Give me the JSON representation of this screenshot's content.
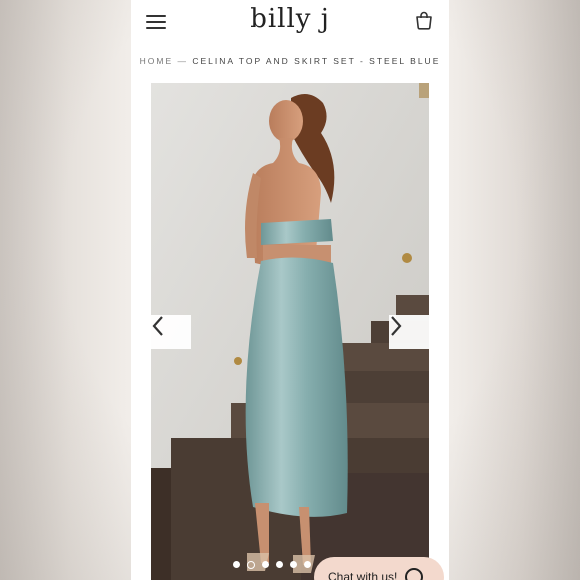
{
  "header": {
    "logo": "billy j",
    "menu_icon": "hamburger-menu-icon",
    "cart_icon": "shopping-bag-icon"
  },
  "breadcrumb": {
    "home": "HOME",
    "separator": "—",
    "current": "CELINA TOP AND SKIRT SET - STEEL BLUE"
  },
  "gallery": {
    "prev_icon": "chevron-left-icon",
    "next_icon": "chevron-right-icon",
    "dots_count": 6,
    "active_dot": 2
  },
  "chat": {
    "label": "Chat with us!",
    "icon": "chat-bubble-icon",
    "background": "#f3d9cd"
  },
  "colors": {
    "dress": "#8fb2b3",
    "background_wall": "#dcdbd7",
    "stairs": "#4a3c33"
  }
}
